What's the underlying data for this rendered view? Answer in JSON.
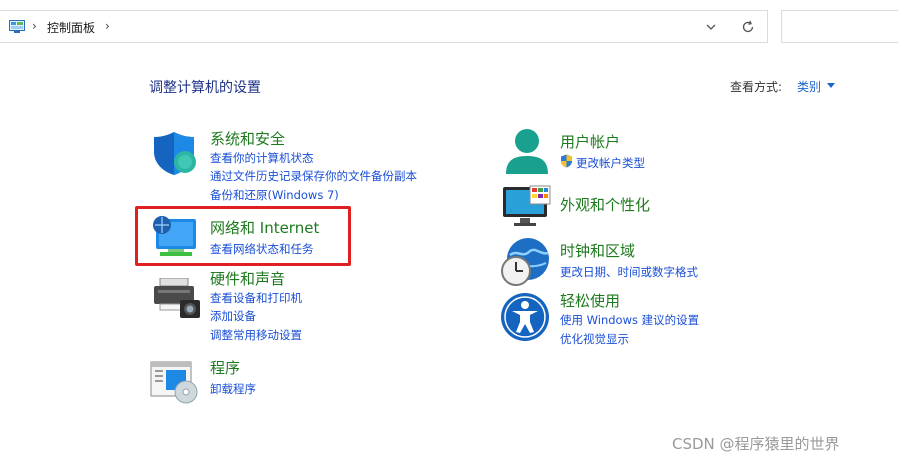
{
  "address_bar": {
    "breadcrumb": "控制面板",
    "chevron": "›"
  },
  "main": {
    "title": "调整计算机的设置",
    "view_by_label": "查看方式:",
    "view_by_value": "类别"
  },
  "categories": {
    "system": {
      "title": "系统和安全",
      "links": [
        "查看你的计算机状态",
        "通过文件历史记录保存你的文件备份副本",
        "备份和还原(Windows 7)"
      ],
      "icon": "shield-icon"
    },
    "network": {
      "title": "网络和 Internet",
      "links": [
        "查看网络状态和任务"
      ],
      "icon": "network-globe-icon"
    },
    "hardware": {
      "title": "硬件和声音",
      "links": [
        "查看设备和打印机",
        "添加设备",
        "调整常用移动设置"
      ],
      "icon": "printer-icon"
    },
    "programs": {
      "title": "程序",
      "links": [
        "卸载程序"
      ],
      "icon": "programs-icon"
    },
    "user": {
      "title": "用户帐户",
      "links": [
        "更改帐户类型"
      ],
      "icon": "user-icon"
    },
    "appearance": {
      "title": "外观和个性化",
      "links": [],
      "icon": "monitor-icon"
    },
    "clock": {
      "title": "时钟和区域",
      "links": [
        "更改日期、时间或数字格式"
      ],
      "icon": "clock-globe-icon"
    },
    "ease": {
      "title": "轻松使用",
      "links": [
        "使用 Windows 建议的设置",
        "优化视觉显示"
      ],
      "icon": "accessibility-icon"
    }
  },
  "watermark": "CSDN @程序猿里的世界",
  "colors": {
    "category_title": "#1e7a1e",
    "link": "#1a4fd6",
    "title": "#1e3287",
    "highlight": "#e02020"
  }
}
